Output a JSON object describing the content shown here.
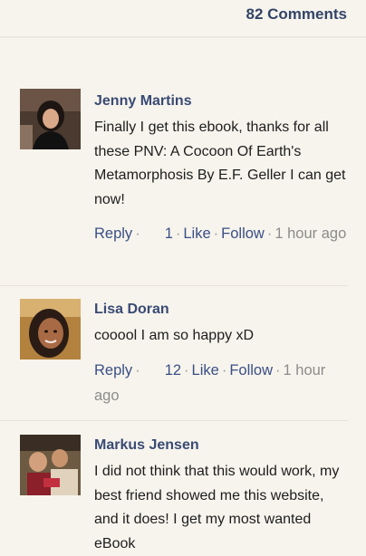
{
  "header": {
    "comment_count": "82 Comments"
  },
  "comments": [
    {
      "author": "Jenny Martins",
      "text": "Finally I get this ebook, thanks for all these PNV: A Cocoon Of Earth's Metamorphosis By E.F. Geller I can get now!",
      "reply": "Reply",
      "likes": "1",
      "like": "Like",
      "follow": "Follow",
      "time": "1 hour ago",
      "avatar_icon": "woman-dark-hair-avatar"
    },
    {
      "author": "Lisa Doran",
      "text": "cooool I am so happy xD",
      "reply": "Reply",
      "likes": "12",
      "like": "Like",
      "follow": "Follow",
      "time": "1 hour ago",
      "avatar_icon": "woman-smiling-avatar"
    },
    {
      "author": "Markus Jensen",
      "text": "I did not think that this would work, my best friend showed me this website, and it does! I get my most wanted eBook",
      "avatar_icon": "group-photo-avatar"
    }
  ],
  "colors": {
    "background": "#f6f4ec",
    "author": "#3a4a75",
    "link": "#3b4f86",
    "meta": "#8c8c8c"
  }
}
